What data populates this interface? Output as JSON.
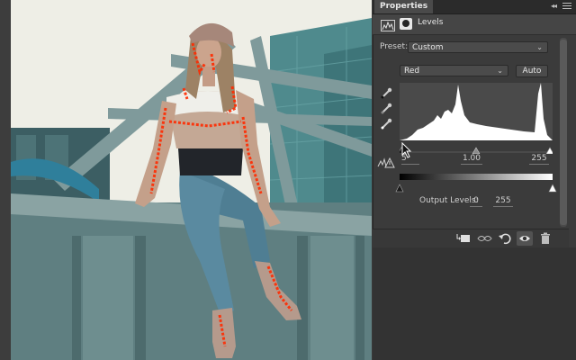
{
  "panel": {
    "tab_label": "Properties",
    "collapse_glyph": "◂◂",
    "header_title": "Levels",
    "preset_label": "Preset:",
    "preset_value": "Custom",
    "channel_value": "Red",
    "auto_label": "Auto",
    "input_black": "5",
    "input_gamma": "1.00",
    "input_white": "255",
    "output_label": "Output Levels:",
    "output_black": "0",
    "output_white": "255"
  },
  "icons": {
    "adjustment": "levels-adjustment-icon",
    "mask": "layer-mask-icon",
    "eyedroppers": [
      "black-point-eyedropper-icon",
      "gray-point-eyedropper-icon",
      "white-point-eyedropper-icon"
    ],
    "footer": [
      "clip-to-layer-icon",
      "view-previous-state-icon",
      "reset-icon",
      "visibility-eye-icon",
      "trash-icon"
    ]
  },
  "colors": {
    "panel_bg": "#3b3b3b",
    "clipping_preview": "#ff2a00"
  }
}
